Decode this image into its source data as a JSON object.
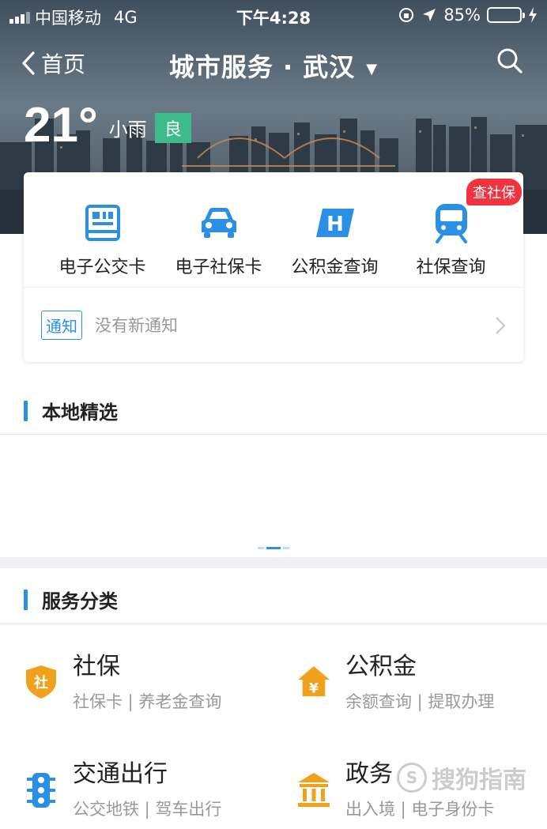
{
  "status_bar": {
    "carrier": "中国移动",
    "network": "4G",
    "time": "下午4:28",
    "battery_percent": "85%",
    "battery_level": 0.85
  },
  "nav": {
    "back_label": "首页",
    "title": "城市服务 · 武汉",
    "back_icon": "chevron-left-icon",
    "search_icon": "search-icon"
  },
  "weather": {
    "temperature": "21°",
    "condition": "小雨",
    "air_quality": "良"
  },
  "quick_services": {
    "badge": "查社保",
    "items": [
      {
        "label": "电子公交卡",
        "icon": "bus-card-icon"
      },
      {
        "label": "电子社保卡",
        "icon": "car-icon"
      },
      {
        "label": "公积金查询",
        "icon": "housing-fund-icon"
      },
      {
        "label": "社保查询",
        "icon": "train-icon"
      }
    ]
  },
  "notice": {
    "tag": "通知",
    "text": "没有新通知"
  },
  "sections": {
    "local": "本地精选",
    "categories": "服务分类"
  },
  "services": [
    {
      "name": "社保",
      "sub": "社保卡 | 养老金查询",
      "icon": "shield-icon"
    },
    {
      "name": "公积金",
      "sub": "余额查询 | 提取办理",
      "icon": "house-yuan-icon"
    },
    {
      "name": "交通出行",
      "sub": "公交地铁 | 驾车出行",
      "icon": "traffic-light-icon"
    },
    {
      "name": "政务",
      "sub": "出入境 | 电子身份卡",
      "icon": "government-building-icon"
    }
  ],
  "watermark": "搜狗指南",
  "colors": {
    "accent": "#2a90e6",
    "aqi_green": "#3dbb8a",
    "badge_red": "#f0333e",
    "service_orange": "#f0a21c"
  }
}
